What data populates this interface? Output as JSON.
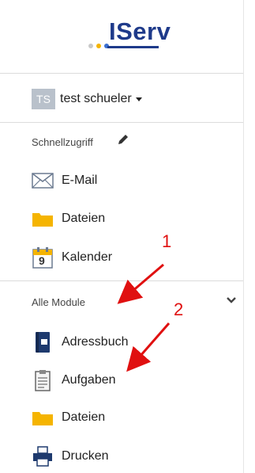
{
  "app": {
    "logo_text": "IServ"
  },
  "colors": {
    "brand": "#1e3a8a",
    "annotation": "#e01010",
    "folder": "#f5b400"
  },
  "user": {
    "initials": "TS",
    "name": "test schueler"
  },
  "quick_access": {
    "label": "Schnellzugriff",
    "items": [
      {
        "label": "E-Mail",
        "icon": "envelope-icon"
      },
      {
        "label": "Dateien",
        "icon": "folder-icon"
      },
      {
        "label": "Kalender",
        "icon": "calendar-icon",
        "icon_text": "9"
      }
    ]
  },
  "all_modules": {
    "label": "Alle Module",
    "items": [
      {
        "label": "Adressbuch",
        "icon": "address-book-icon"
      },
      {
        "label": "Aufgaben",
        "icon": "clipboard-icon"
      },
      {
        "label": "Dateien",
        "icon": "folder-icon"
      },
      {
        "label": "Drucken",
        "icon": "printer-icon"
      }
    ]
  },
  "annotations": {
    "first": "1",
    "second": "2"
  }
}
